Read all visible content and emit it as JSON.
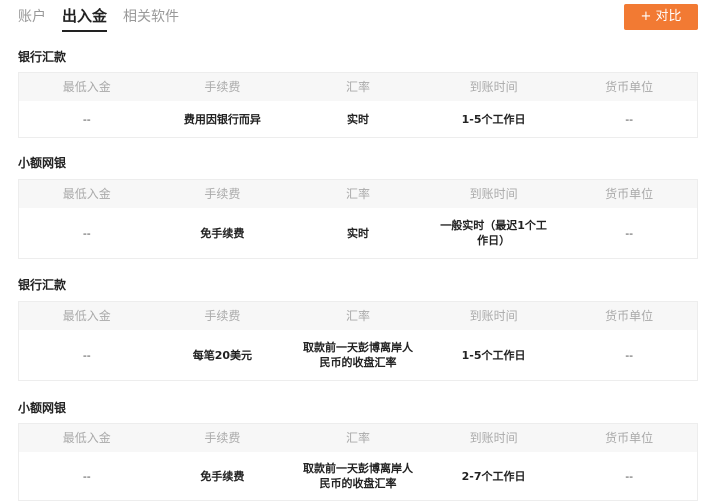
{
  "tabs": [
    {
      "label": "账户",
      "active": false
    },
    {
      "label": "出入金",
      "active": true
    },
    {
      "label": "相关软件",
      "active": false
    }
  ],
  "compare_button": "+ 对比",
  "columns": [
    "最低入金",
    "手续费",
    "汇率",
    "到账时间",
    "货币单位"
  ],
  "sections": [
    {
      "title": "银行汇款",
      "row": [
        "--",
        "费用因银行而异",
        "实时",
        "1-5个工作日",
        "--"
      ]
    },
    {
      "title": "小额网银",
      "row": [
        "--",
        "免手续费",
        "实时",
        "一般实时（最迟1个工作日）",
        "--"
      ]
    },
    {
      "title": "银行汇款",
      "row": [
        "--",
        "每笔20美元",
        "取款前一天彭博离岸人民币的收盘汇率",
        "1-5个工作日",
        "--"
      ]
    },
    {
      "title": "小额网银",
      "row": [
        "--",
        "免手续费",
        "取款前一天彭博离岸人民币的收盘汇率",
        "2-7个工作日",
        "--"
      ]
    }
  ],
  "colors": {
    "accent": "#f27a33",
    "header_bg": "#f7f7f7",
    "border": "#ededed"
  }
}
